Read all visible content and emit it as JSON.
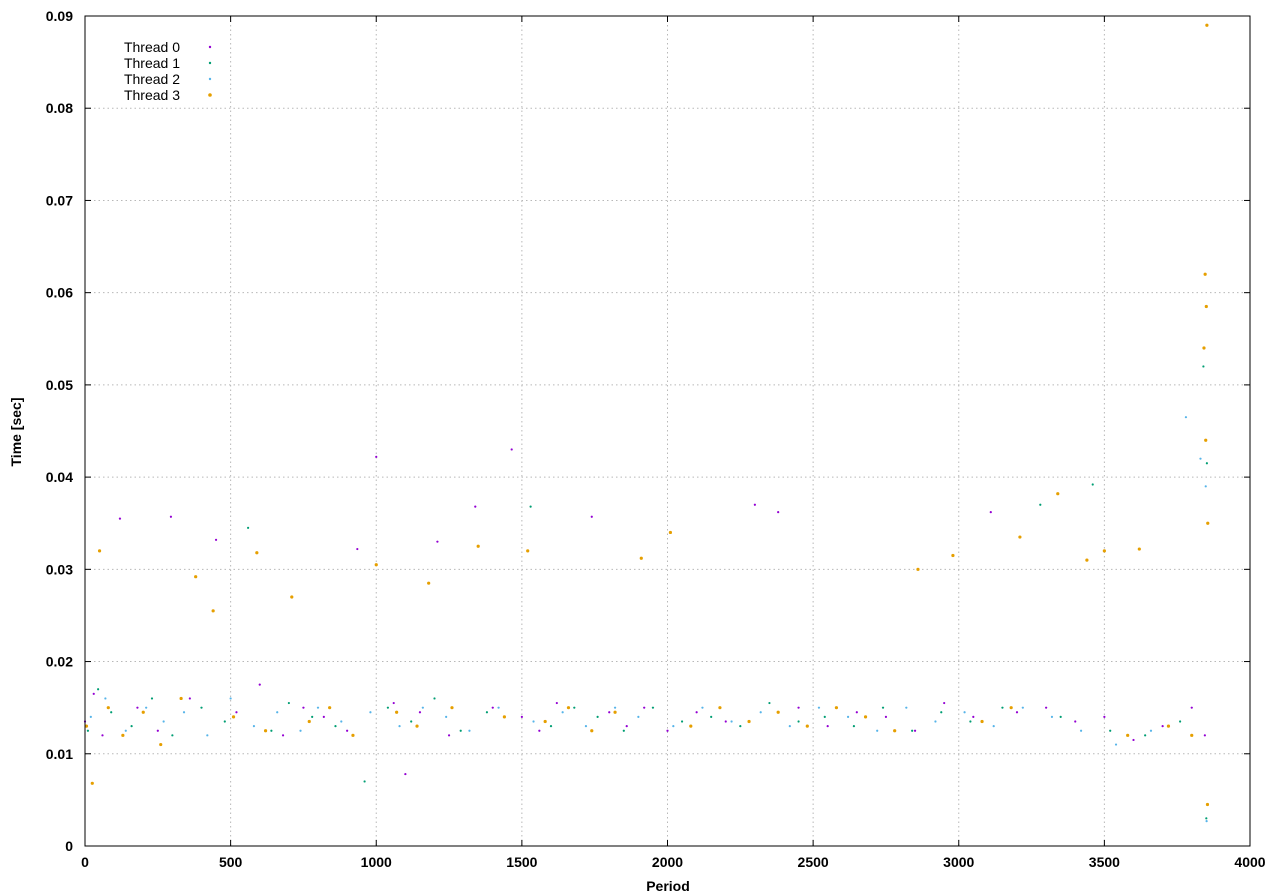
{
  "chart_data": {
    "type": "scatter",
    "title": "",
    "xlabel": "Period",
    "ylabel": "Time [sec]",
    "xlim": [
      0,
      4000
    ],
    "ylim": [
      0,
      0.09
    ],
    "grid": true,
    "legend_position": "top-left",
    "x_ticks": [
      "0",
      "500",
      "1000",
      "1500",
      "2000",
      "2500",
      "3000",
      "3500",
      "4000"
    ],
    "y_ticks": [
      "0",
      "0.01",
      "0.02",
      "0.03",
      "0.04",
      "0.05",
      "0.06",
      "0.07",
      "0.08",
      "0.09"
    ],
    "series": [
      {
        "name": "Thread 0",
        "color": "#9400d3",
        "points": [
          [
            0,
            0.0135
          ],
          [
            30,
            0.0165
          ],
          [
            60,
            0.012
          ],
          [
            120,
            0.0355
          ],
          [
            180,
            0.015
          ],
          [
            250,
            0.0125
          ],
          [
            295,
            0.0357
          ],
          [
            360,
            0.016
          ],
          [
            450,
            0.0332
          ],
          [
            520,
            0.0145
          ],
          [
            600,
            0.0175
          ],
          [
            680,
            0.012
          ],
          [
            750,
            0.015
          ],
          [
            820,
            0.014
          ],
          [
            900,
            0.0125
          ],
          [
            935,
            0.0322
          ],
          [
            1000,
            0.0422
          ],
          [
            1060,
            0.0155
          ],
          [
            1100,
            0.0078
          ],
          [
            1150,
            0.0145
          ],
          [
            1210,
            0.033
          ],
          [
            1250,
            0.012
          ],
          [
            1340,
            0.0368
          ],
          [
            1400,
            0.015
          ],
          [
            1465,
            0.043
          ],
          [
            1500,
            0.014
          ],
          [
            1560,
            0.0125
          ],
          [
            1620,
            0.0155
          ],
          [
            1740,
            0.0357
          ],
          [
            1800,
            0.0145
          ],
          [
            1860,
            0.013
          ],
          [
            1920,
            0.015
          ],
          [
            2000,
            0.0125
          ],
          [
            2100,
            0.0145
          ],
          [
            2200,
            0.0135
          ],
          [
            2300,
            0.037
          ],
          [
            2380,
            0.0362
          ],
          [
            2450,
            0.015
          ],
          [
            2550,
            0.013
          ],
          [
            2650,
            0.0145
          ],
          [
            2750,
            0.014
          ],
          [
            2850,
            0.0125
          ],
          [
            2950,
            0.0155
          ],
          [
            3050,
            0.014
          ],
          [
            3110,
            0.0362
          ],
          [
            3200,
            0.0145
          ],
          [
            3300,
            0.015
          ],
          [
            3400,
            0.0135
          ],
          [
            3500,
            0.014
          ],
          [
            3600,
            0.0115
          ],
          [
            3700,
            0.013
          ],
          [
            3800,
            0.015
          ],
          [
            3845,
            0.012
          ]
        ]
      },
      {
        "name": "Thread 1",
        "color": "#009e73",
        "points": [
          [
            10,
            0.0125
          ],
          [
            45,
            0.017
          ],
          [
            90,
            0.0145
          ],
          [
            160,
            0.013
          ],
          [
            230,
            0.016
          ],
          [
            300,
            0.012
          ],
          [
            400,
            0.015
          ],
          [
            480,
            0.0135
          ],
          [
            560,
            0.0345
          ],
          [
            640,
            0.0125
          ],
          [
            700,
            0.0155
          ],
          [
            780,
            0.014
          ],
          [
            860,
            0.013
          ],
          [
            960,
            0.007
          ],
          [
            1040,
            0.015
          ],
          [
            1120,
            0.0135
          ],
          [
            1200,
            0.016
          ],
          [
            1290,
            0.0125
          ],
          [
            1380,
            0.0145
          ],
          [
            1530,
            0.0368
          ],
          [
            1600,
            0.013
          ],
          [
            1680,
            0.015
          ],
          [
            1760,
            0.014
          ],
          [
            1850,
            0.0125
          ],
          [
            1950,
            0.015
          ],
          [
            2050,
            0.0135
          ],
          [
            2150,
            0.014
          ],
          [
            2250,
            0.013
          ],
          [
            2350,
            0.0155
          ],
          [
            2450,
            0.0135
          ],
          [
            2540,
            0.014
          ],
          [
            2640,
            0.013
          ],
          [
            2740,
            0.015
          ],
          [
            2840,
            0.0125
          ],
          [
            2940,
            0.0145
          ],
          [
            3040,
            0.0135
          ],
          [
            3150,
            0.015
          ],
          [
            3280,
            0.037
          ],
          [
            3350,
            0.014
          ],
          [
            3460,
            0.0392
          ],
          [
            3520,
            0.0125
          ],
          [
            3640,
            0.012
          ],
          [
            3760,
            0.0135
          ],
          [
            3840,
            0.052
          ],
          [
            3850,
            0.003
          ],
          [
            3852,
            0.0415
          ]
        ]
      },
      {
        "name": "Thread 2",
        "color": "#56b4e9",
        "points": [
          [
            20,
            0.014
          ],
          [
            70,
            0.016
          ],
          [
            140,
            0.0125
          ],
          [
            210,
            0.015
          ],
          [
            270,
            0.0135
          ],
          [
            340,
            0.0145
          ],
          [
            420,
            0.012
          ],
          [
            500,
            0.016
          ],
          [
            580,
            0.013
          ],
          [
            660,
            0.0145
          ],
          [
            740,
            0.0125
          ],
          [
            800,
            0.015
          ],
          [
            880,
            0.0135
          ],
          [
            980,
            0.0145
          ],
          [
            1080,
            0.013
          ],
          [
            1160,
            0.015
          ],
          [
            1240,
            0.014
          ],
          [
            1320,
            0.0125
          ],
          [
            1420,
            0.015
          ],
          [
            1540,
            0.0135
          ],
          [
            1640,
            0.0145
          ],
          [
            1720,
            0.013
          ],
          [
            1820,
            0.015
          ],
          [
            1900,
            0.014
          ],
          [
            2020,
            0.013
          ],
          [
            2120,
            0.015
          ],
          [
            2220,
            0.0135
          ],
          [
            2320,
            0.0145
          ],
          [
            2420,
            0.013
          ],
          [
            2520,
            0.015
          ],
          [
            2620,
            0.014
          ],
          [
            2720,
            0.0125
          ],
          [
            2820,
            0.015
          ],
          [
            2920,
            0.0135
          ],
          [
            3020,
            0.0145
          ],
          [
            3120,
            0.013
          ],
          [
            3220,
            0.015
          ],
          [
            3320,
            0.014
          ],
          [
            3420,
            0.0125
          ],
          [
            3540,
            0.011
          ],
          [
            3660,
            0.0125
          ],
          [
            3780,
            0.0465
          ],
          [
            3830,
            0.042
          ],
          [
            3848,
            0.039
          ],
          [
            3851,
            0.0027
          ]
        ]
      },
      {
        "name": "Thread 3",
        "color": "#e69f00",
        "points": [
          [
            5,
            0.013
          ],
          [
            25,
            0.0068
          ],
          [
            50,
            0.032
          ],
          [
            80,
            0.015
          ],
          [
            130,
            0.012
          ],
          [
            200,
            0.0145
          ],
          [
            260,
            0.011
          ],
          [
            330,
            0.016
          ],
          [
            380,
            0.0292
          ],
          [
            440,
            0.0255
          ],
          [
            510,
            0.014
          ],
          [
            590,
            0.0318
          ],
          [
            620,
            0.0125
          ],
          [
            710,
            0.027
          ],
          [
            770,
            0.0135
          ],
          [
            840,
            0.015
          ],
          [
            920,
            0.012
          ],
          [
            1000,
            0.0305
          ],
          [
            1070,
            0.0145
          ],
          [
            1140,
            0.013
          ],
          [
            1180,
            0.0285
          ],
          [
            1260,
            0.015
          ],
          [
            1350,
            0.0325
          ],
          [
            1440,
            0.014
          ],
          [
            1520,
            0.032
          ],
          [
            1580,
            0.0135
          ],
          [
            1660,
            0.015
          ],
          [
            1740,
            0.0125
          ],
          [
            1820,
            0.0145
          ],
          [
            1910,
            0.0312
          ],
          [
            2010,
            0.034
          ],
          [
            2080,
            0.013
          ],
          [
            2180,
            0.015
          ],
          [
            2280,
            0.0135
          ],
          [
            2380,
            0.0145
          ],
          [
            2480,
            0.013
          ],
          [
            2580,
            0.015
          ],
          [
            2680,
            0.014
          ],
          [
            2780,
            0.0125
          ],
          [
            2860,
            0.03
          ],
          [
            2980,
            0.0315
          ],
          [
            3080,
            0.0135
          ],
          [
            3180,
            0.015
          ],
          [
            3210,
            0.0335
          ],
          [
            3340,
            0.0382
          ],
          [
            3440,
            0.031
          ],
          [
            3500,
            0.032
          ],
          [
            3580,
            0.012
          ],
          [
            3620,
            0.0322
          ],
          [
            3720,
            0.013
          ],
          [
            3800,
            0.012
          ],
          [
            3842,
            0.054
          ],
          [
            3846,
            0.062
          ],
          [
            3848,
            0.044
          ],
          [
            3850,
            0.0585
          ],
          [
            3852,
            0.089
          ],
          [
            3854,
            0.0045
          ],
          [
            3855,
            0.035
          ]
        ]
      }
    ]
  }
}
